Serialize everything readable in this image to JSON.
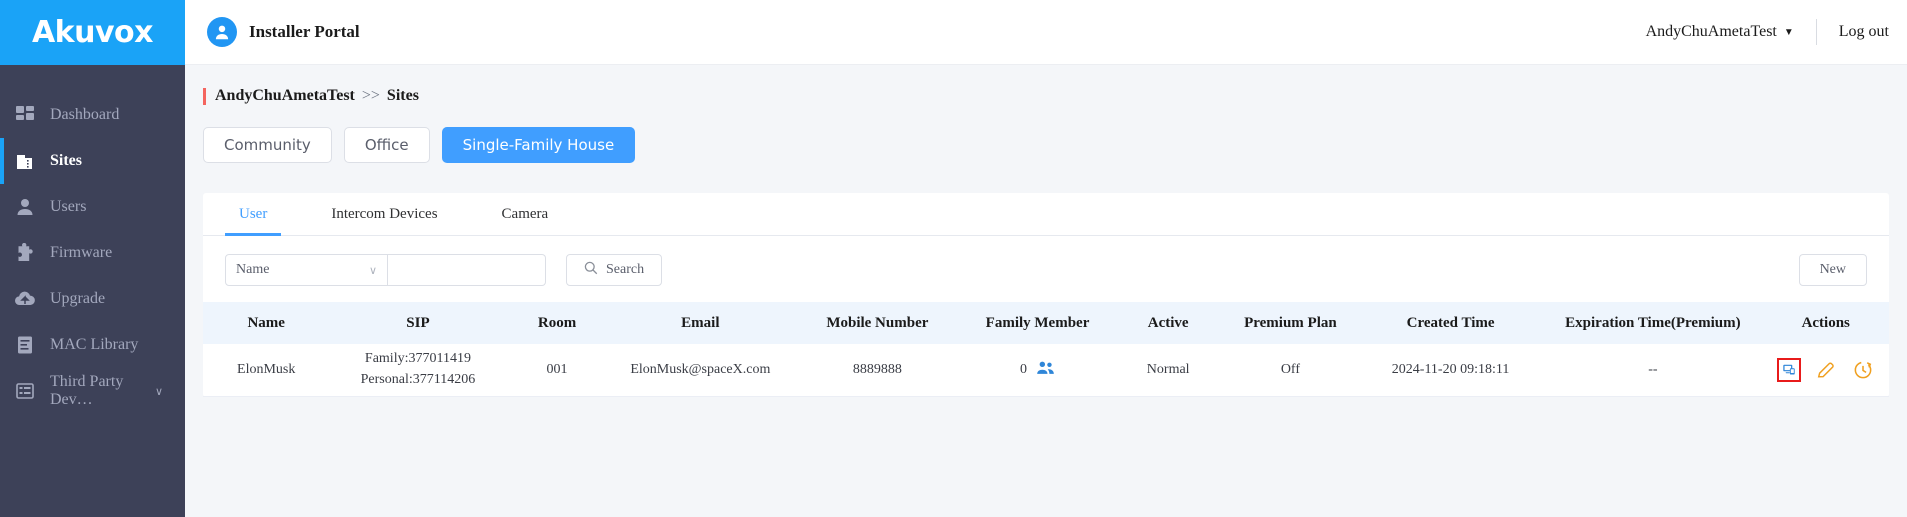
{
  "brand": {
    "logo_text": "Akuvox",
    "logo_bg": "#1aa3f7",
    "accent": "#409eff",
    "sidebar_bg": "#3d4158"
  },
  "header": {
    "portal_title": "Installer Portal",
    "account_name": "AndyChuAmetaTest",
    "account_caret": "▼",
    "logout_label": "Log out",
    "avatar_icon": "user-avatar-icon"
  },
  "sidebar": {
    "items": [
      {
        "label": "Dashboard",
        "icon": "dashboard-grid-icon",
        "active": false,
        "expandable": false
      },
      {
        "label": "Sites",
        "icon": "building-icon",
        "active": true,
        "expandable": false
      },
      {
        "label": "Users",
        "icon": "user-icon",
        "active": false,
        "expandable": false
      },
      {
        "label": "Firmware",
        "icon": "puzzle-piece-icon",
        "active": false,
        "expandable": false
      },
      {
        "label": "Upgrade",
        "icon": "cloud-upload-icon",
        "active": false,
        "expandable": false
      },
      {
        "label": "MAC Library",
        "icon": "document-list-icon",
        "active": false,
        "expandable": false
      },
      {
        "label": "Third Party Dev…",
        "icon": "list-panel-icon",
        "active": false,
        "expandable": true,
        "chevron": "∨"
      }
    ]
  },
  "breadcrumb": {
    "root": "AndyChuAmetaTest",
    "separator": ">>",
    "current": "Sites",
    "accent_color": "#f4655f"
  },
  "site_types": [
    {
      "label": "Community",
      "active": false
    },
    {
      "label": "Office",
      "active": false
    },
    {
      "label": "Single-Family House",
      "active": true
    }
  ],
  "tabs": [
    {
      "label": "User",
      "active": true
    },
    {
      "label": "Intercom Devices",
      "active": false
    },
    {
      "label": "Camera",
      "active": false
    }
  ],
  "search": {
    "field_selected": "Name",
    "field_caret": "∨",
    "input_value": "",
    "input_placeholder": "",
    "search_button": "Search",
    "search_icon": "magnifier-icon",
    "new_button": "New"
  },
  "table": {
    "columns": [
      "Name",
      "SIP",
      "Room",
      "Email",
      "Mobile Number",
      "Family Member",
      "Active",
      "Premium Plan",
      "Created Time",
      "Expiration Time(Premium)",
      "Actions"
    ],
    "rows": [
      {
        "name": "ElonMusk",
        "sip_family": "Family:377011419",
        "sip_personal": "Personal:377114206",
        "room": "001",
        "email": "ElonMusk@spaceX.com",
        "mobile_number": "8889888",
        "family_member_count": "0",
        "family_member_icon": "people-group-icon",
        "active": "Normal",
        "premium_plan": "Off",
        "created_time": "2024-11-20 09:18:11",
        "expiration_time": "--",
        "actions": [
          {
            "icon": "monitor-device-icon",
            "highlighted": true,
            "color": "#2f86d8"
          },
          {
            "icon": "pencil-edit-icon",
            "highlighted": false,
            "color": "#f0a020"
          },
          {
            "icon": "reset-refresh-icon",
            "highlighted": false,
            "color": "#f0a020"
          }
        ]
      }
    ]
  }
}
